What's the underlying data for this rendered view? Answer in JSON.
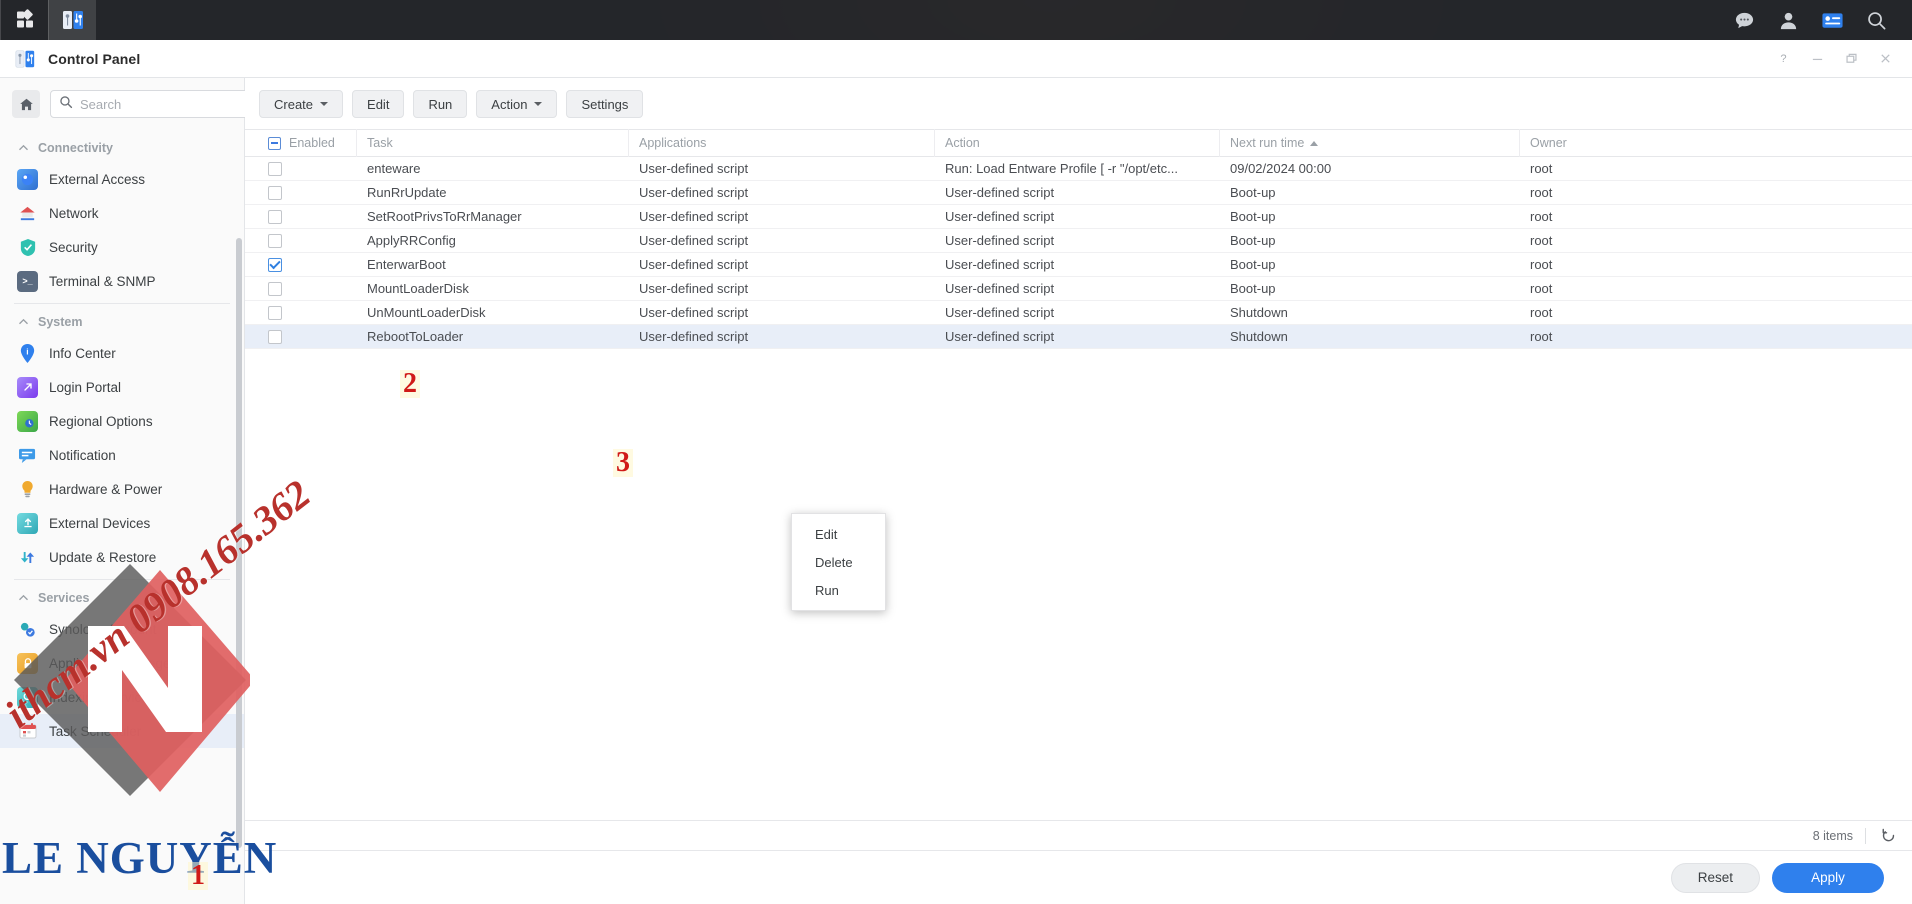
{
  "taskbar": {
    "left_icons": [
      {
        "name": "apps-grid-icon",
        "label": "Main Menu"
      },
      {
        "name": "control-panel-icon",
        "label": "Control Panel"
      }
    ],
    "right_icons": [
      {
        "name": "chat-bubble-icon",
        "label": "Chat"
      },
      {
        "name": "user-account-icon",
        "label": "Account"
      },
      {
        "name": "notification-panel-icon",
        "label": "Notifications"
      },
      {
        "name": "search-icon",
        "label": "Search"
      }
    ]
  },
  "window": {
    "title": "Control Panel",
    "controls": {
      "help": "?",
      "minimize": "—",
      "maximize": "❐",
      "close": "×"
    }
  },
  "sidebar": {
    "search": {
      "placeholder": "Search",
      "value": ""
    },
    "home_label": "Home",
    "groups": [
      {
        "label": "Connectivity",
        "items": [
          {
            "label": "External Access",
            "icon": "external-access-icon",
            "color": "#3b82f6",
            "glyph": "↗"
          },
          {
            "label": "Network",
            "icon": "network-icon",
            "color": "#e05252",
            "glyph": "⌂"
          },
          {
            "label": "Security",
            "icon": "security-icon",
            "color": "#2fc1b0",
            "glyph": "✔"
          },
          {
            "label": "Terminal & SNMP",
            "icon": "terminal-snmp-icon",
            "color": "#5b6b80",
            "glyph": ">_"
          }
        ]
      },
      {
        "label": "System",
        "items": [
          {
            "label": "Info Center",
            "icon": "info-center-icon",
            "color": "#2f80ed",
            "glyph": "i"
          },
          {
            "label": "Login Portal",
            "icon": "login-portal-icon",
            "color": "#8b5cf6",
            "glyph": "↗"
          },
          {
            "label": "Regional Options",
            "icon": "regional-options-icon",
            "color": "#5fb85f",
            "glyph": "◔"
          },
          {
            "label": "Notification",
            "icon": "notification-icon",
            "color": "#3d9ae8",
            "glyph": "≡"
          },
          {
            "label": "Hardware & Power",
            "icon": "hardware-power-icon",
            "color": "#f0a92e",
            "glyph": "●"
          },
          {
            "label": "External Devices",
            "icon": "external-devices-icon",
            "color": "#46c0c8",
            "glyph": "↑"
          },
          {
            "label": "Update & Restore",
            "icon": "update-restore-icon",
            "color": "#2fb3c9",
            "glyph": "↻"
          }
        ]
      },
      {
        "label": "Services",
        "items": [
          {
            "label": "Synology Account",
            "icon": "synology-account-icon",
            "color": "#2aa9b5",
            "glyph": "●"
          },
          {
            "label": "Application Privileges",
            "icon": "application-privileges-icon",
            "color": "#f0a92e",
            "glyph": "⚿"
          },
          {
            "label": "Indexing Service",
            "icon": "indexing-service-icon",
            "color": "#35c4c4",
            "glyph": "⚲"
          },
          {
            "label": "Task Scheduler",
            "icon": "task-scheduler-icon",
            "color": "#e05252",
            "glyph": "▦"
          }
        ]
      }
    ],
    "selected_item": "Task Scheduler"
  },
  "toolbar": {
    "create_label": "Create",
    "edit_label": "Edit",
    "run_label": "Run",
    "action_label": "Action",
    "settings_label": "Settings"
  },
  "table": {
    "columns": [
      {
        "key": "enabled",
        "label": "Enabled"
      },
      {
        "key": "task",
        "label": "Task"
      },
      {
        "key": "applications",
        "label": "Applications"
      },
      {
        "key": "action",
        "label": "Action"
      },
      {
        "key": "next_run_time",
        "label": "Next run time",
        "sorted": "asc"
      },
      {
        "key": "owner",
        "label": "Owner"
      }
    ],
    "header_checkbox_state": "indeterminate",
    "rows": [
      {
        "enabled": false,
        "task": "enteware",
        "applications": "User-defined script",
        "action": "Run: Load Entware Profile [ -r \"/opt/etc...",
        "next_run_time": "09/02/2024 00:00",
        "owner": "root",
        "selected": false
      },
      {
        "enabled": false,
        "task": "RunRrUpdate",
        "applications": "User-defined script",
        "action": "User-defined script",
        "next_run_time": "Boot-up",
        "owner": "root",
        "selected": false
      },
      {
        "enabled": false,
        "task": "SetRootPrivsToRrManager",
        "applications": "User-defined script",
        "action": "User-defined script",
        "next_run_time": "Boot-up",
        "owner": "root",
        "selected": false
      },
      {
        "enabled": false,
        "task": "ApplyRRConfig",
        "applications": "User-defined script",
        "action": "User-defined script",
        "next_run_time": "Boot-up",
        "owner": "root",
        "selected": false
      },
      {
        "enabled": true,
        "task": "EnterwarBoot",
        "applications": "User-defined script",
        "action": "User-defined script",
        "next_run_time": "Boot-up",
        "owner": "root",
        "selected": false
      },
      {
        "enabled": false,
        "task": "MountLoaderDisk",
        "applications": "User-defined script",
        "action": "User-defined script",
        "next_run_time": "Boot-up",
        "owner": "root",
        "selected": false
      },
      {
        "enabled": false,
        "task": "UnMountLoaderDisk",
        "applications": "User-defined script",
        "action": "User-defined script",
        "next_run_time": "Shutdown",
        "owner": "root",
        "selected": false
      },
      {
        "enabled": false,
        "task": "RebootToLoader",
        "applications": "User-defined script",
        "action": "User-defined script",
        "next_run_time": "Shutdown",
        "owner": "root",
        "selected": true
      }
    ],
    "item_count_label": "8 items"
  },
  "context_menu": {
    "items": [
      {
        "label": "Edit"
      },
      {
        "label": "Delete"
      },
      {
        "label": "Run"
      }
    ]
  },
  "bottom_bar": {
    "reset_label": "Reset",
    "apply_label": "Apply"
  },
  "annotations": [
    {
      "id": "step-1",
      "label": "1"
    },
    {
      "id": "step-2",
      "label": "2"
    },
    {
      "id": "step-3",
      "label": "3"
    }
  ],
  "watermark": {
    "diagonal_text": "ithcm.vn 0908.165.362",
    "brand_text": "LE NGUYỄN",
    "colors": {
      "red": "#e06060",
      "gray": "#5a5a5a",
      "blue": "#1a4e9e",
      "text_red": "#b8312c"
    }
  },
  "colors": {
    "accent": "#2f80ed",
    "selection": "#e8eef8",
    "taskbar": "#26282d",
    "annotation_red": "#d01a18"
  }
}
